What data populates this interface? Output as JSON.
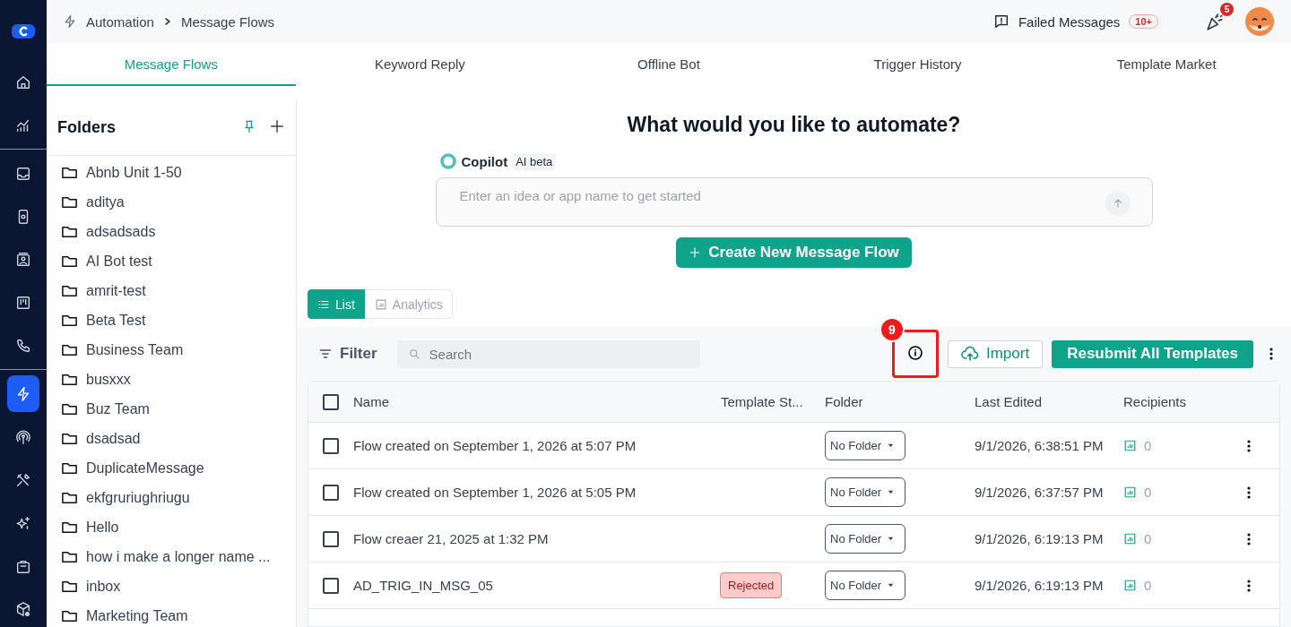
{
  "nav_groups": [
    [
      {
        "selected": false
      },
      {
        "selected": false
      }
    ],
    [
      {
        "selected": false
      },
      {
        "selected": false
      },
      {
        "selected": false
      },
      {
        "selected": false
      },
      {
        "selected": false
      }
    ],
    [
      {
        "selected": true
      },
      {
        "selected": false
      },
      {
        "selected": false
      },
      {
        "selected": false
      },
      {
        "selected": false
      },
      {
        "selected": false
      }
    ]
  ],
  "breadcrumb": [
    "Automation",
    "Message Flows"
  ],
  "header": {
    "failed_messages": "Failed Messages",
    "failed_count": "10+",
    "notification_count": "5"
  },
  "tabs": [
    {
      "label": "Message Flows",
      "selected": true
    },
    {
      "label": "Keyword Reply",
      "selected": false
    },
    {
      "label": "Offline Bot",
      "selected": false
    },
    {
      "label": "Trigger History",
      "selected": false
    },
    {
      "label": "Template Market",
      "selected": false
    }
  ],
  "folders": {
    "title": "Folders",
    "items": [
      "Abnb Unit 1-50",
      "aditya",
      "adsadsads",
      "AI Bot test",
      "amrit-test",
      "Beta Test",
      "Business Team",
      "busxxx",
      "Buz Team",
      "dsadsad",
      "DuplicateMessage",
      "ekfgruriughriugu",
      "Hello",
      "how i make a longer name ...",
      "inbox",
      "Marketing Team"
    ]
  },
  "heading": "What would you like to automate?",
  "copilot": {
    "name": "Copilot",
    "tag": "AI beta",
    "placeholder": "Enter an idea or app name to get started"
  },
  "create_button": "Create New Message Flow",
  "views": [
    {
      "label": "List",
      "selected": true
    },
    {
      "label": "Analytics",
      "selected": false
    }
  ],
  "toolbar": {
    "filter": "Filter",
    "search_placeholder": "Search",
    "import": "Import",
    "resubmit": "Resubmit All Templates",
    "annotation": "9"
  },
  "table": {
    "all_checked": false,
    "columns": [
      "Name",
      "Template St...",
      "Folder",
      "Last Edited",
      "Recipients"
    ],
    "rows": [
      {
        "checked": false,
        "name": "Flow created on September 1, 2026 at 5:07 PM",
        "folder": "No Folder",
        "edited": "9/1/2026, 6:38:51 PM",
        "recipients": "0"
      },
      {
        "checked": false,
        "name": "Flow created on September 1, 2026 at 5:05 PM",
        "folder": "No Folder",
        "edited": "9/1/2026, 6:37:57 PM",
        "recipients": "0"
      },
      {
        "checked": false,
        "name": "Flow creaer 21, 2025 at 1:32 PM",
        "folder": "No Folder",
        "edited": "9/1/2026, 6:19:13 PM",
        "recipients": "0"
      },
      {
        "checked": false,
        "name": "AD_TRIG_IN_MSG_05",
        "status": {
          "kind": "rejected",
          "label": "Rejected"
        },
        "folder": "No Folder",
        "edited": "9/1/2026, 6:19:13 PM",
        "recipients": "0"
      }
    ]
  }
}
